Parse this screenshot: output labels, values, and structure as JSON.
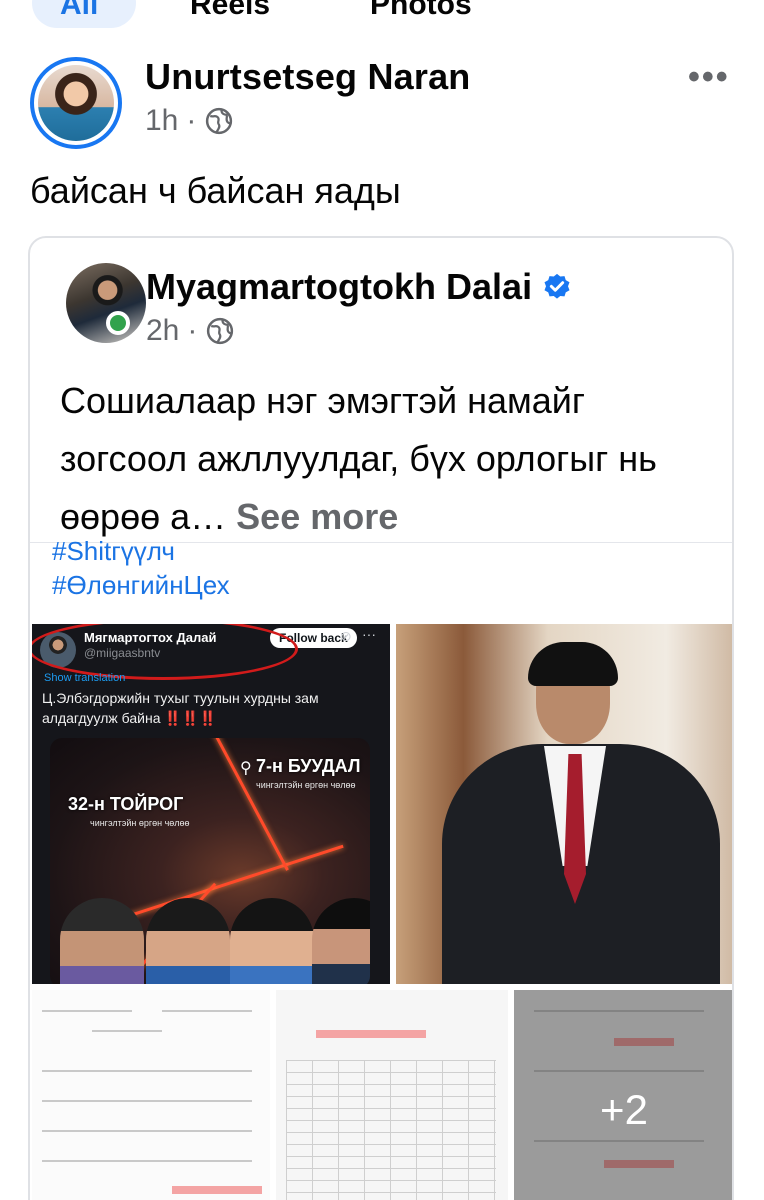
{
  "tabs": {
    "all": "All",
    "reels": "Reels",
    "photos": "Photos"
  },
  "post": {
    "author": "Unurtsetseg Naran",
    "time": "1h",
    "separator": "·",
    "privacy_icon": "globe-icon",
    "more_icon": "more-options-icon",
    "more_label": "•••",
    "text": "байсан ч байсан яады"
  },
  "shared": {
    "author": "Myagmartogtokh Dalai",
    "verified_icon": "verified-badge-icon",
    "time": "2h",
    "separator": "·",
    "privacy_icon": "globe-icon",
    "text": "Сошиалаар нэг эмэгтэй намайг зогсоол ажллуулдаг, бүх орлогыг нь  өөрөө а…",
    "see_more": "See more",
    "hashtags": [
      "#Shitгүүлч",
      "#ӨлөнгийнЦех"
    ]
  },
  "tweet": {
    "name": "Мягмартогтох Далай",
    "handle": "@miigaasbntv",
    "follow": "Follow back",
    "translate": "Show translation",
    "text": "Ц.Элбэгдоржийн тухыг туулын хурдны зам алдагдуулж байна",
    "exclaim": "‼️‼️‼️",
    "map_label_1": "7-н БУУДАЛ",
    "map_sub_1": "чингэлтэйн өргөн чөлөө",
    "map_label_2": "32-н ТОЙРОГ",
    "map_sub_2": "чингэлтэйн өргөн чөлөө"
  },
  "media": {
    "more_count": "+2"
  },
  "colors": {
    "accent": "#1877f2",
    "link": "#1b74e4",
    "muted": "#65676b",
    "online": "#31a24c"
  }
}
